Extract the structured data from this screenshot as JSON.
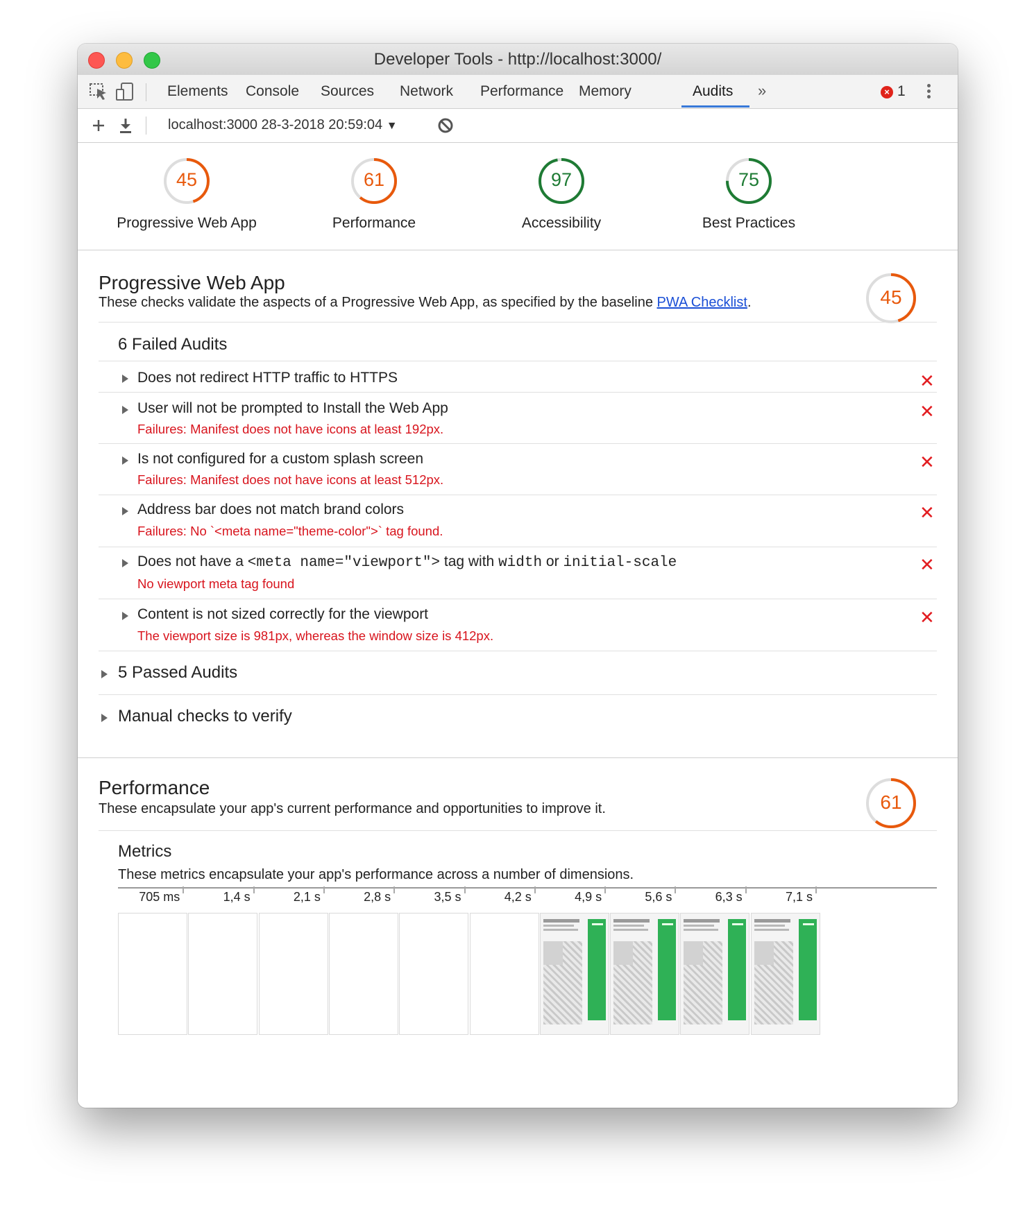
{
  "window": {
    "title": "Developer Tools - http://localhost:3000/"
  },
  "tabs": [
    "Elements",
    "Console",
    "Sources",
    "Network",
    "Performance",
    "Memory",
    "Audits"
  ],
  "active_tab": "Audits",
  "more_tabs_glyph": "»",
  "error_count": "1",
  "report_selector": {
    "label": "localhost:3000 28-3-2018 20:59:04",
    "caret": "▼"
  },
  "score_gauges": [
    {
      "label": "Progressive Web App",
      "score": "45",
      "fraction": 0.45,
      "color": "#e8590c"
    },
    {
      "label": "Performance",
      "score": "61",
      "fraction": 0.61,
      "color": "#e8590c"
    },
    {
      "label": "Accessibility",
      "score": "97",
      "fraction": 0.97,
      "color": "#1e7b34"
    },
    {
      "label": "Best Practices",
      "score": "75",
      "fraction": 0.75,
      "color": "#1e7b34"
    }
  ],
  "pwa": {
    "title": "Progressive Web App",
    "desc_prefix": "These checks validate the aspects of a Progressive Web App, as specified by the baseline ",
    "desc_link": "PWA Checklist",
    "desc_suffix": ".",
    "score": "45",
    "failed_header": "6 Failed Audits",
    "audits": [
      {
        "title": "Does not redirect HTTP traffic to HTTPS",
        "failure": ""
      },
      {
        "title": "User will not be prompted to Install the Web App",
        "failure": "Failures: Manifest does not have icons at least 192px."
      },
      {
        "title": "Is not configured for a custom splash screen",
        "failure": "Failures: Manifest does not have icons at least 512px."
      },
      {
        "title": "Address bar does not match brand colors",
        "failure": "Failures: No `<meta name=\"theme-color\">` tag found."
      },
      {
        "title_parts": [
          "Does not have a ",
          "<meta name=\"viewport\">",
          " tag with ",
          "width",
          " or ",
          "initial-scale"
        ],
        "failure": "No viewport meta tag found"
      },
      {
        "title": "Content is not sized correctly for the viewport",
        "failure": "The viewport size is 981px, whereas the window size is 412px."
      }
    ],
    "passed_header": "5 Passed Audits",
    "manual_header": "Manual checks to verify"
  },
  "performance": {
    "title": "Performance",
    "desc": "These encapsulate your app's current performance and opportunities to improve it.",
    "score": "61",
    "metrics_title": "Metrics",
    "metrics_desc": "These metrics encapsulate your app's performance across a number of dimensions.",
    "timeline_ticks": [
      "705 ms",
      "1,4 s",
      "2,1 s",
      "2,8 s",
      "3,5 s",
      "4,2 s",
      "4,9 s",
      "5,6 s",
      "6,3 s",
      "7,1 s"
    ],
    "frames_with_content": [
      false,
      false,
      false,
      false,
      false,
      false,
      true,
      true,
      true,
      true
    ],
    "progress_fraction": 0.58
  }
}
